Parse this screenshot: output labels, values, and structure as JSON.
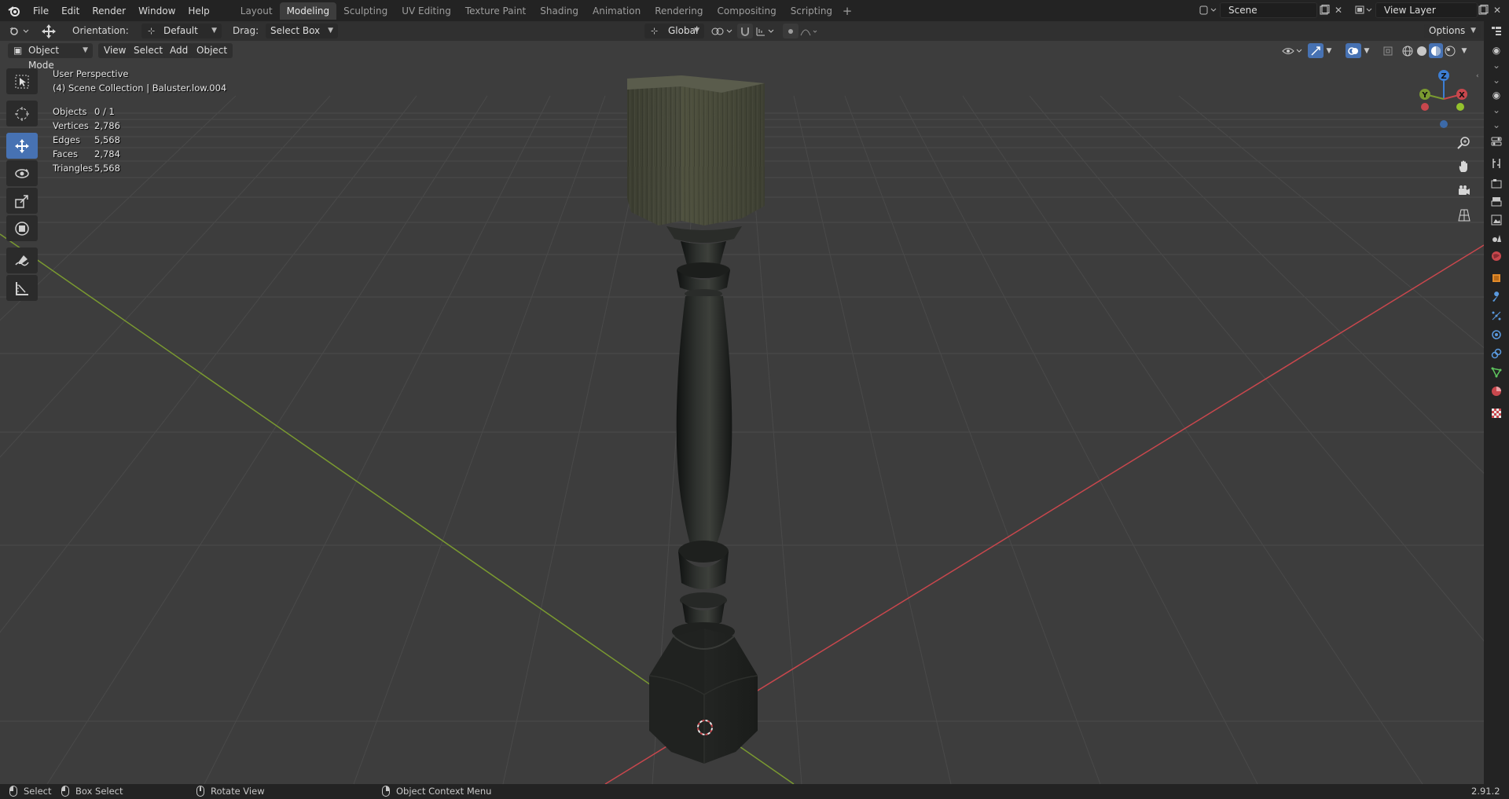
{
  "app": {
    "menus": [
      "File",
      "Edit",
      "Render",
      "Window",
      "Help"
    ],
    "workspaces": [
      "Layout",
      "Modeling",
      "Sculpting",
      "UV Editing",
      "Texture Paint",
      "Shading",
      "Animation",
      "Rendering",
      "Compositing",
      "Scripting"
    ],
    "active_workspace": "Modeling",
    "add_workspace_symbol": "+",
    "scene_name": "Scene",
    "view_layer_name": "View Layer"
  },
  "tool_header": {
    "orientation_label": "Orientation:",
    "orientation_value": "Default",
    "drag_label": "Drag:",
    "drag_value": "Select Box",
    "transform_orientation": "Global",
    "options_label": "Options"
  },
  "viewport_header": {
    "mode": "Object Mode",
    "view": "View",
    "select": "Select",
    "add": "Add",
    "object": "Object"
  },
  "overlay": {
    "perspective": "User Perspective",
    "collection": "(4) Scene Collection | Baluster.low.004",
    "stats": [
      {
        "key": "Objects",
        "value": "0 / 1"
      },
      {
        "key": "Vertices",
        "value": "2,786"
      },
      {
        "key": "Edges",
        "value": "5,568"
      },
      {
        "key": "Faces",
        "value": "2,784"
      },
      {
        "key": "Triangles",
        "value": "5,568"
      }
    ]
  },
  "gizmo": {
    "x_label": "X",
    "y_label": "Y",
    "z_label": "Z"
  },
  "statusbar": {
    "select": "Select",
    "box_select": "Box Select",
    "rotate_view": "Rotate View",
    "context_menu": "Object Context Menu",
    "version": "2.91.2"
  },
  "colors": {
    "accent": "#4772b3",
    "x_axis": "#c8474d",
    "y_axis": "#7a9a30",
    "z_axis": "#3c7ed4",
    "viewport_bg": "#3d3d3d"
  },
  "tools": [
    "select-box-icon",
    "cursor-icon",
    "move-icon",
    "rotate-icon",
    "scale-icon",
    "transform-icon",
    "annotate-icon",
    "measure-icon"
  ],
  "active_tool": "move-icon"
}
